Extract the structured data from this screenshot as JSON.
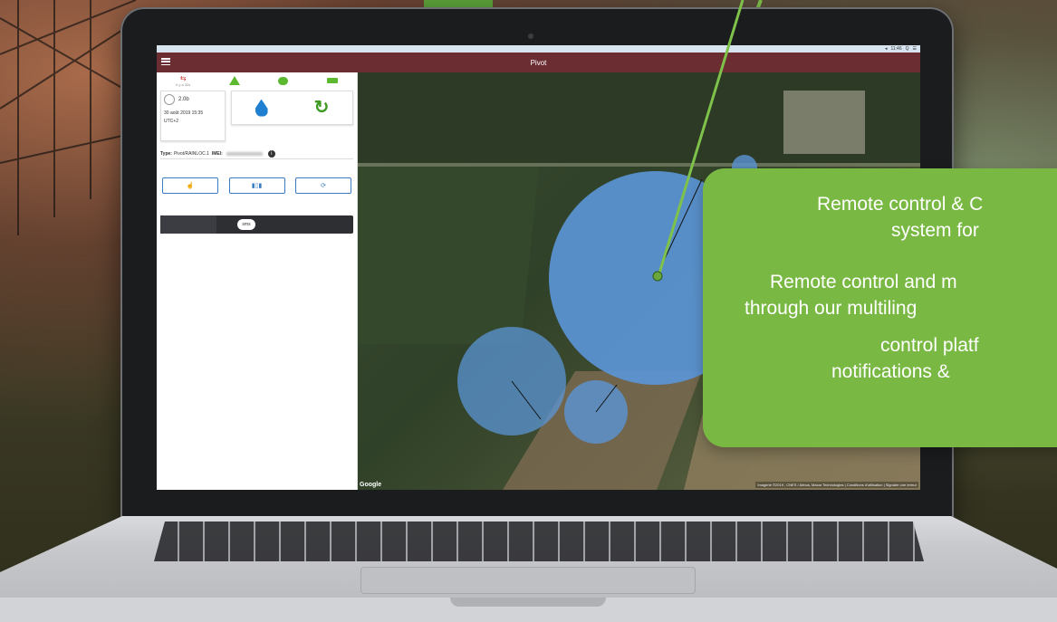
{
  "app": {
    "title": "Pivot",
    "sysbar": [
      "◂",
      "11:46",
      "Q",
      "☰"
    ]
  },
  "panel": {
    "status_label": "Il y a 32s",
    "pressure": "2.0b",
    "date": "30 août 2019 15:35",
    "timezone": "UTC+2",
    "type_label": "Type:",
    "type_value": "Pivot/RAINLOC.1",
    "imei_label": "IMEI:",
    "info_icon": "i",
    "sms_label": "sms"
  },
  "map": {
    "google_label": "Google",
    "attribution": "Imagerie ©2019 , CNES / Airbus, Maxar Technologies | Conditions d'utilisation | Signaler une erreur"
  },
  "callout": {
    "line1": "Remote control & C",
    "line2": "system for",
    "line3": "Remote control and m",
    "line4": "through our multiling",
    "line5": "control platf",
    "line6": "notifications &"
  },
  "colors": {
    "titlebar": "#6b2d32",
    "accent_green": "#79b943",
    "pivot_blue": "#5b95d6"
  }
}
